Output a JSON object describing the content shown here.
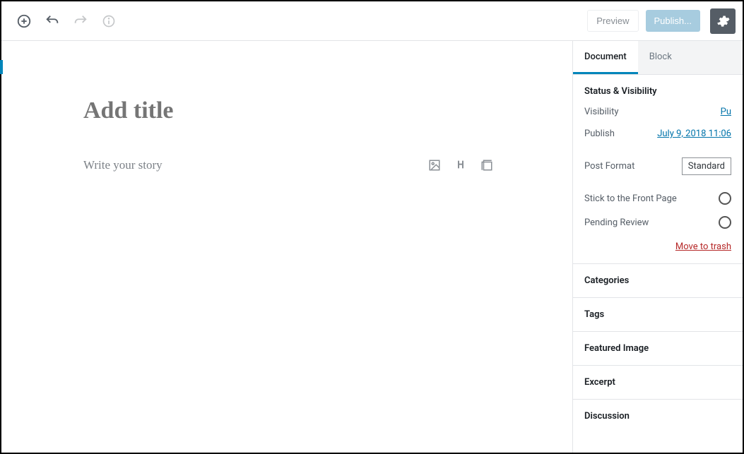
{
  "toolbar": {
    "preview_label": "Preview",
    "publish_label": "Publish..."
  },
  "editor": {
    "title_placeholder": "Add title",
    "story_placeholder": "Write your story"
  },
  "sidebar": {
    "tabs": {
      "document": "Document",
      "block": "Block"
    },
    "status": {
      "heading": "Status & Visibility",
      "visibility_label": "Visibility",
      "visibility_value": "Pu",
      "publish_label": "Publish",
      "publish_value": "July 9, 2018 11:06",
      "post_format_label": "Post Format",
      "post_format_value": "Standard",
      "stick_label": "Stick to the Front Page",
      "pending_label": "Pending Review",
      "trash_label": "Move to trash"
    },
    "panels": {
      "categories": "Categories",
      "tags": "Tags",
      "featured_image": "Featured Image",
      "excerpt": "Excerpt",
      "discussion": "Discussion"
    }
  }
}
